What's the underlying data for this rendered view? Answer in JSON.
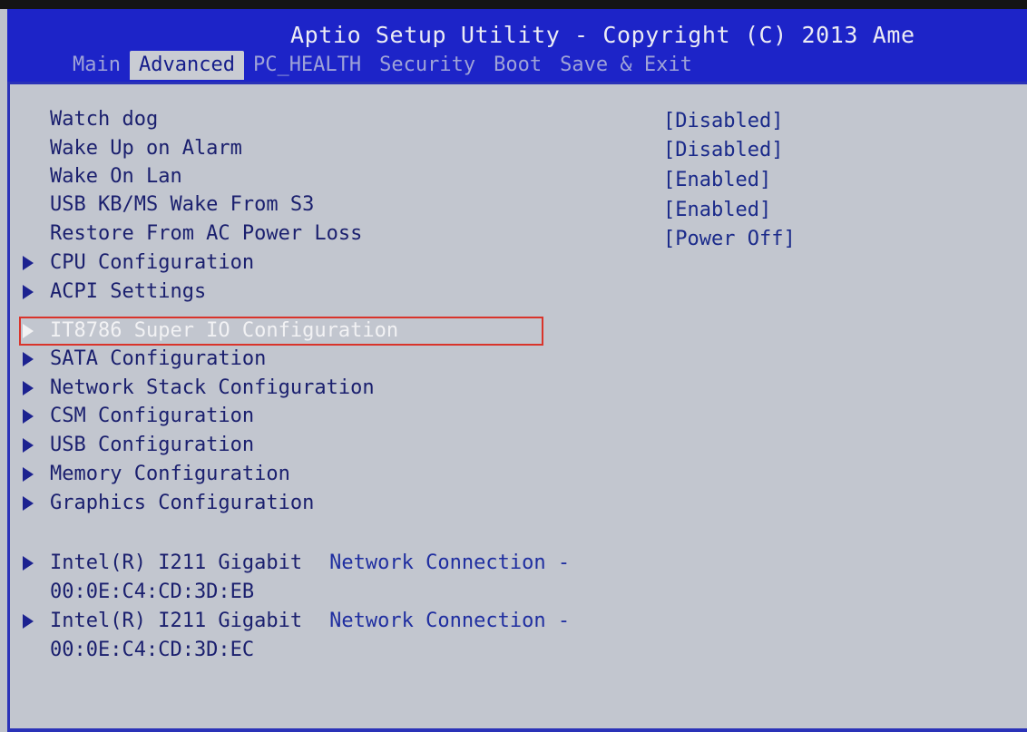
{
  "window": {
    "title": "Aptio Setup Utility - Copyright (C) 2013 Ame"
  },
  "tabs": [
    {
      "label": "Main",
      "active": false
    },
    {
      "label": "Advanced",
      "active": true
    },
    {
      "label": "PC_HEALTH",
      "active": false
    },
    {
      "label": "Security",
      "active": false
    },
    {
      "label": "Boot",
      "active": false
    },
    {
      "label": "Save & Exit",
      "active": false
    }
  ],
  "settings": [
    {
      "label": "Watch dog",
      "value": "[Disabled]"
    },
    {
      "label": "Wake Up on Alarm",
      "value": "[Disabled]"
    },
    {
      "label": "Wake On Lan",
      "value": "[Enabled]"
    },
    {
      "label": "USB KB/MS Wake From S3",
      "value": "[Enabled]"
    },
    {
      "label": "Restore From AC Power Loss",
      "value": "[Power Off]"
    }
  ],
  "submenus": [
    {
      "label": "CPU Configuration"
    },
    {
      "label": "ACPI Settings"
    },
    {
      "label": "IT8786 Super IO Configuration",
      "selected": true
    },
    {
      "label": "SATA Configuration"
    },
    {
      "label": "Network Stack Configuration"
    },
    {
      "label": "CSM Configuration"
    },
    {
      "label": "USB Configuration"
    },
    {
      "label": "Memory Configuration"
    },
    {
      "label": "Graphics Configuration"
    }
  ],
  "nics": [
    {
      "line1a": "Intel(R) I211 Gigabit",
      "line1b": "Network Connection -",
      "mac": "00:0E:C4:CD:3D:EB"
    },
    {
      "line1a": "Intel(R) I211 Gigabit",
      "line1b": "Network Connection -",
      "mac": "00:0E:C4:CD:3D:EC"
    }
  ],
  "colors": {
    "header_bg": "#1d24c8",
    "panel_bg": "#c2c6cf",
    "selection_border": "#d9342b",
    "text": "#1a1f6e"
  },
  "icons": {
    "submenu": "right-triangle-icon"
  }
}
